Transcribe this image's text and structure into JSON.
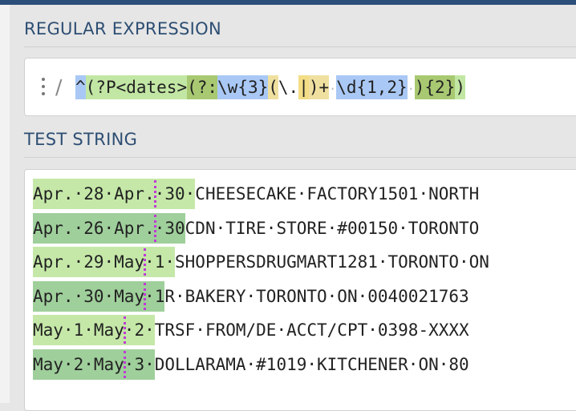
{
  "sections": {
    "regex_title": "REGULAR EXPRESSION",
    "test_title": "TEST STRING"
  },
  "regex": {
    "delimiter": "/",
    "tokens": [
      {
        "text": "^",
        "hl": "#a9c8f5"
      },
      {
        "text": "(?P<dates>",
        "hl": "#c2e7a4"
      },
      {
        "text": "(?:",
        "hl": "#a8c972"
      },
      {
        "text": "\\w{3}",
        "hl": "#a9c8f5"
      },
      {
        "text": "(",
        "hl": "#f0e0a0"
      },
      {
        "text": "\\.",
        "hl": "#ffffff"
      },
      {
        "text": "|",
        "hl": "#f3dd86"
      },
      {
        "text": ")+",
        "hl": "#f0e0a0"
      },
      {
        "text": "·",
        "hl": "#ffffff"
      },
      {
        "text": "\\d{1,2}",
        "hl": "#a9c8f5"
      },
      {
        "text": "·",
        "hl": "#ffffff"
      },
      {
        "text": "){2}",
        "hl": "#a8c972"
      },
      {
        "text": ")",
        "hl": "#c2e7a4"
      }
    ]
  },
  "test_lines": [
    {
      "match_a": "Apr.·28·Apr.",
      "match_b": "·30·",
      "rest": "CHEESECAKE·FACTORY1501·NORTH",
      "shade": "m1"
    },
    {
      "match_a": "Apr.·26·Apr.",
      "match_b": "·30",
      "rest": "CDN·TIRE·STORE·#00150·TORONTO",
      "shade": "m2"
    },
    {
      "match_a": "Apr.·29·May",
      "match_b": "·1·",
      "rest": "SHOPPERSDRUGMART1281·TORONTO·ON",
      "shade": "m1"
    },
    {
      "match_a": "Apr.·30·May",
      "match_b": "·1",
      "rest": "R·BAKERY·TORONTO·ON·0040021763",
      "shade": "m2"
    },
    {
      "match_a": "May·1·May",
      "match_b": "·2·",
      "rest": "TRSF·FROM/DE·ACCT/CPT·0398-XXXX",
      "shade": "m1"
    },
    {
      "match_a": "May·2·May",
      "match_b": "·3·",
      "rest": "DOLLARAMA·#1019·KITCHENER·ON·80",
      "shade": "m2"
    }
  ]
}
